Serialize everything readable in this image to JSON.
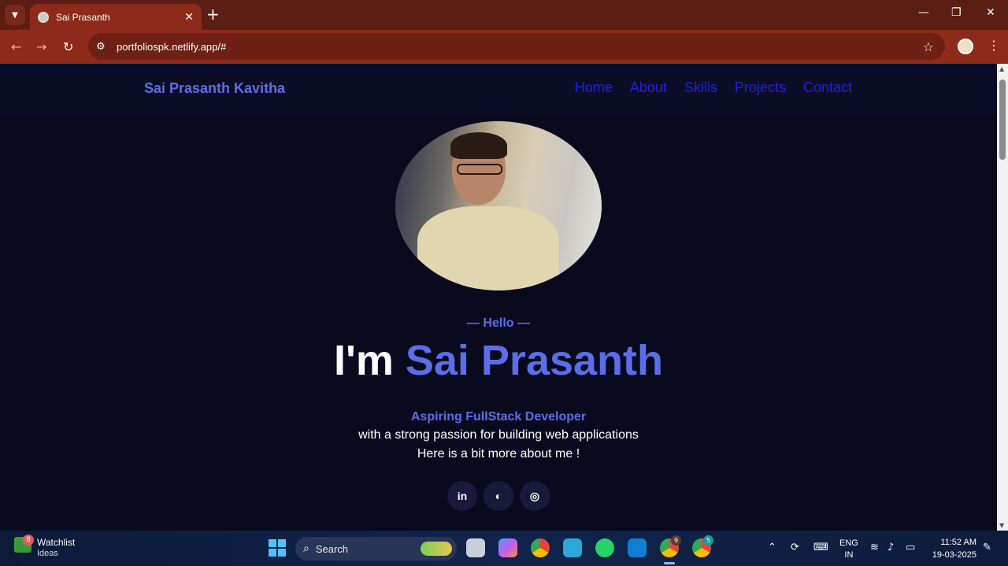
{
  "browser": {
    "tab_title": "Sai Prasanth",
    "url": "portfoliospk.netlify.app/#",
    "new_tab": "+",
    "tab_close": "✕",
    "win_min": "—",
    "win_max": "❐",
    "win_close": "✕"
  },
  "site": {
    "brand": "Sai Prasanth Kavitha",
    "nav": [
      "Home",
      "About",
      "Skills",
      "Projects",
      "Contact"
    ],
    "hello": "— Hello —",
    "headline_prefix": "I'm ",
    "headline_name": "Sai Prasanth",
    "role": "Aspiring FullStack Developer",
    "tagline": "with a strong passion for building web applications",
    "more": "Here is a bit more about me !",
    "socials": [
      "in",
      "◐",
      "◎"
    ],
    "colors": {
      "accent": "#5b6ee8",
      "nav_link": "#1f1fd8",
      "background": "#0a0a1f"
    }
  },
  "taskbar": {
    "widget_badge": "8",
    "widget_title": "Watchlist",
    "widget_sub": "Ideas",
    "search_label": "Search",
    "chrome_badge_1": "9",
    "chrome_badge_2": "5",
    "lang_top": "ENG",
    "lang_bottom": "IN",
    "time": "11:52 AM",
    "date": "19-03-2025"
  }
}
